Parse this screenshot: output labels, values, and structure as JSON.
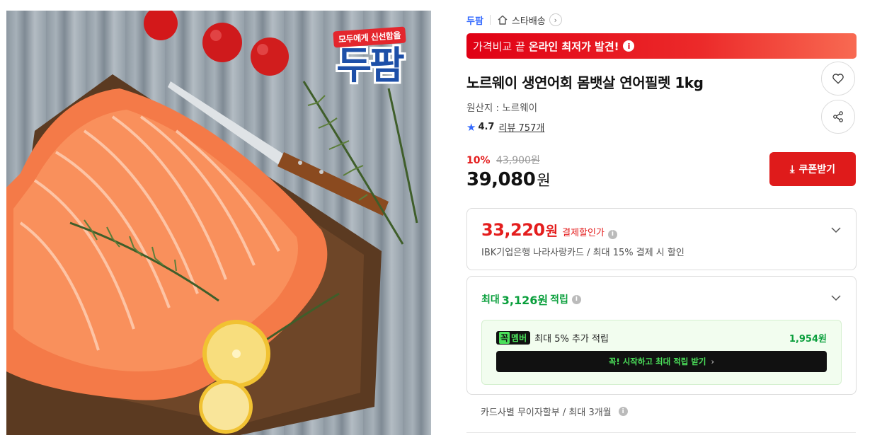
{
  "image": {
    "badge_tag": "모두에게 신선함을",
    "badge_logo": "두팜"
  },
  "breadcrumb": {
    "shop": "두팜",
    "delivery": "스타배송"
  },
  "promo": {
    "light_text": "가격비교 끝",
    "bold_text": "온라인 최저가 발견!"
  },
  "product": {
    "title": "노르웨이 생연어회 몸뱃살 연어필렛 1kg",
    "origin": "원산지 : 노르웨이",
    "rating": "4.7",
    "review_text": "리뷰 757개"
  },
  "price": {
    "discount_rate": "10%",
    "original_price": "43,900원",
    "sale_price": "39,080",
    "sale_unit": "원",
    "coupon_label": "쿠폰받기"
  },
  "card_discount": {
    "price": "33,220",
    "unit": "원",
    "label": "결제할인가",
    "description": "IBK기업은행 나라사랑카드 / 최대 15% 결제 시 할인"
  },
  "points": {
    "prefix": "최대",
    "amount": "3,126원",
    "suffix": "적립",
    "member_k": "꼭",
    "member_m": "멤버",
    "member_text": "최대 5% 추가 적립",
    "member_bonus": "1,954원",
    "cta": "꼭! 시작하고 최대 적립 받기"
  },
  "installment": "카드사별 무이자할부 / 최대 3개월",
  "colors": {
    "accent_red": "#df1b1b",
    "brand_blue": "#346aff",
    "points_green": "#0a9f3c"
  }
}
